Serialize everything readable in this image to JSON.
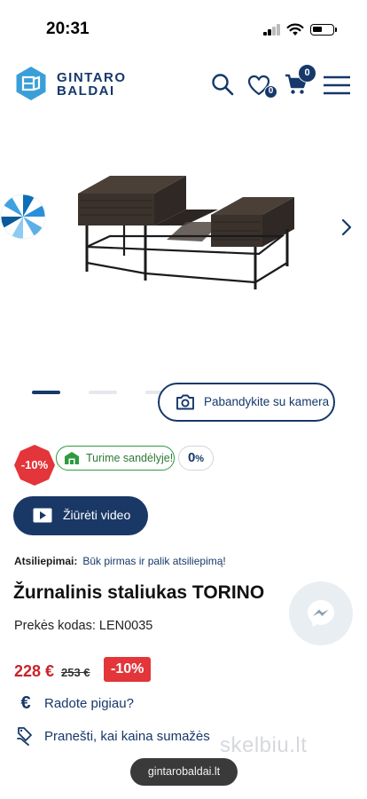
{
  "status_bar": {
    "time": "20:31",
    "battery_level": 0.5
  },
  "header": {
    "brand_line1": "GINTARO",
    "brand_line2": "BALDAI",
    "wishlist_count": "0",
    "cart_count": "0"
  },
  "gallery": {
    "current_slide": 1,
    "total_slides": 4,
    "camera_button": "Pabandykite su kamera"
  },
  "badges": {
    "discount": "-10%",
    "stock": "Turime sandėlyje!",
    "installment_value": "0",
    "installment_unit": "%"
  },
  "video_button": "Žiūrėti video",
  "reviews": {
    "label": "Atsiliepimai:",
    "link": "Būk pirmas ir palik atsiliepimą!"
  },
  "product": {
    "title": "Žurnalinis staliukas TORINO",
    "sku_label": "Prekės kodas: LEN0035",
    "price_current": "228 €",
    "price_old": "253 €",
    "price_discount": "-10%"
  },
  "links": {
    "found_cheaper": "Radote pigiau?",
    "price_alert": "Pranešti, kai kaina sumažės"
  },
  "watermark": "skelbiu.lt",
  "url": "gintarobaldai.lt",
  "colors": {
    "brand": "#16386a",
    "price": "#c8232b",
    "discount": "#e3353a",
    "stock": "#2e9b3e",
    "logo": "#3a9fd8"
  }
}
